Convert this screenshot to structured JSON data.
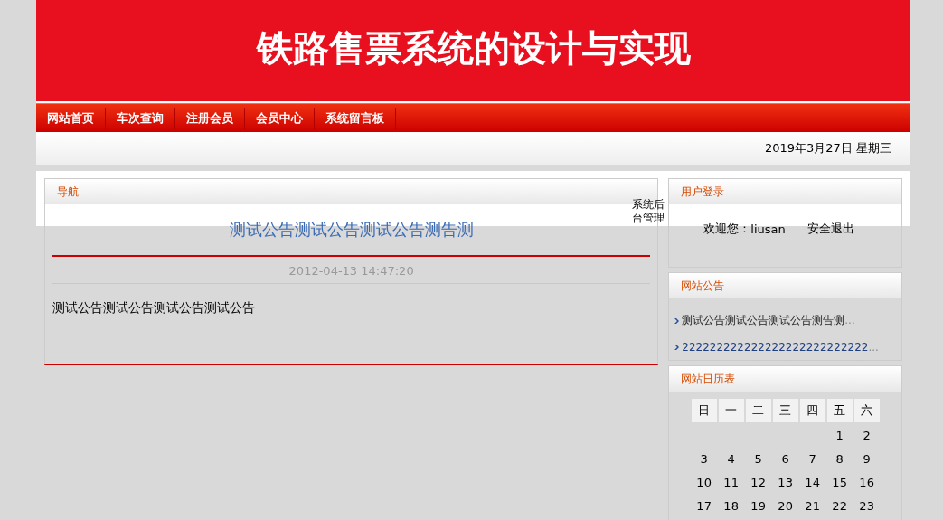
{
  "header": {
    "title": "铁路售票系统的设计与实现"
  },
  "nav": [
    {
      "label": "网站首页"
    },
    {
      "label": "车次查询"
    },
    {
      "label": "注册会员"
    },
    {
      "label": "会员中心"
    },
    {
      "label": "系统留言板"
    }
  ],
  "date_bar": {
    "date": "2019年3月27日 星期三"
  },
  "main_panel": {
    "heading": "导航",
    "side_link": "系统后台管理",
    "title": "测试公告测试公告测试公告测告测",
    "time": "2012-04-13 14:47:20",
    "body": "测试公告测试公告测试公告测试公告"
  },
  "login_panel": {
    "heading": "用户登录",
    "welcome": "欢迎您：",
    "username": "liusan",
    "logout": "安全退出"
  },
  "notice_panel": {
    "heading": "网站公告",
    "items": [
      {
        "text": "测试公告测试公告测试公告测告测",
        "more": "..."
      },
      {
        "text": "222222222222222222222222222",
        "more": "..."
      }
    ]
  },
  "calendar_panel": {
    "heading": "网站日历表",
    "weekdays": [
      "日",
      "一",
      "二",
      "三",
      "四",
      "五",
      "六"
    ],
    "weeks": [
      [
        "1",
        "2"
      ],
      [
        "3",
        "4",
        "5",
        "6",
        "7",
        "8",
        "9"
      ],
      [
        "10",
        "11",
        "12",
        "13",
        "14",
        "15",
        "16"
      ],
      [
        "17",
        "18",
        "19",
        "20",
        "21",
        "22",
        "23"
      ]
    ]
  }
}
